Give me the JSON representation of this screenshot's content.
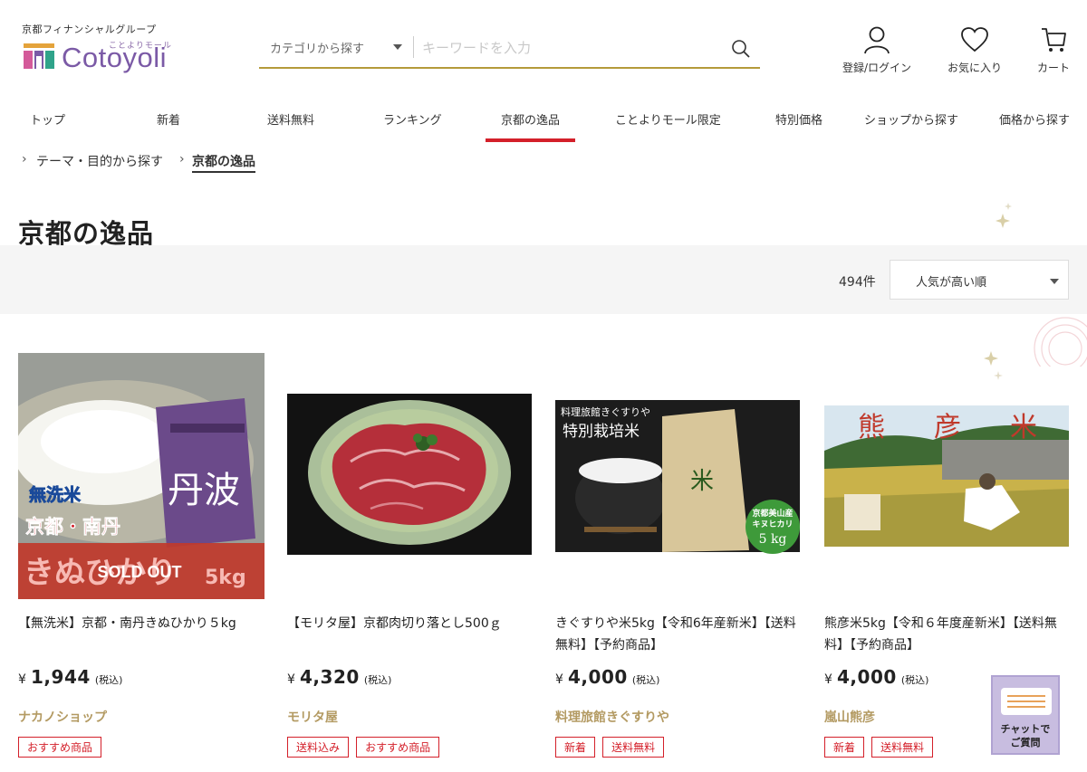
{
  "header": {
    "logo": {
      "group_text": "京都フィナンシャルグループ",
      "mall_text": "ことよりモール",
      "wordmark": "Cotoyoli"
    },
    "search": {
      "category_label": "カテゴリから探す",
      "placeholder": "キーワードを入力"
    },
    "icons": [
      {
        "name": "user-icon",
        "label": "登録/ログイン"
      },
      {
        "name": "heart-icon",
        "label": "お気に入り"
      },
      {
        "name": "cart-icon",
        "label": "カート"
      }
    ]
  },
  "nav": {
    "items": [
      "トップ",
      "新着",
      "送料無料",
      "ランキング",
      "京都の逸品",
      "ことよりモール限定",
      "特別価格",
      "ショップから探す",
      "価格から探す"
    ],
    "active": "京都の逸品"
  },
  "breadcrumb": {
    "items": [
      "テーマ・目的から探す",
      "京都の逸品"
    ]
  },
  "page": {
    "title": "京都の逸品"
  },
  "toolbar": {
    "count": "494件",
    "sort_label": "人気が高い順"
  },
  "products": [
    {
      "image": {
        "tag1": "無洗米",
        "tag2": "京都・南丹",
        "band_text": "きぬひかり",
        "band_weight": "5kg",
        "sold_out": "SOLD OUT",
        "bag_text": "丹波"
      },
      "name": "【無洗米】京都・南丹きぬひかり５kg",
      "price_yen": "¥",
      "price": "1,944",
      "price_tax": "(税込)",
      "shop": "ナカノショップ",
      "tags": [
        "おすすめ商品"
      ]
    },
    {
      "image": {},
      "name": "【モリタ屋】京都肉切り落とし500ｇ",
      "price_yen": "¥",
      "price": "4,320",
      "price_tax": "(税込)",
      "shop": "モリタ屋",
      "tags": [
        "送料込み",
        "おすすめ商品"
      ]
    },
    {
      "image": {
        "top_text": "料理旅館きぐすりや",
        "brand_text": "特別栽培米",
        "badge_line1": "京都美山産",
        "badge_line2": "キヌヒカリ",
        "badge_weight": "5 kg"
      },
      "name": "きぐすりや米5kg【令和6年産新米】【送料無料】【予約商品】",
      "price_yen": "¥",
      "price": "4,000",
      "price_tax": "(税込)",
      "shop": "料理旅館きぐすりや",
      "tags": [
        "新着",
        "送料無料"
      ]
    },
    {
      "image": {
        "chars": [
          "熊",
          "彦",
          "米"
        ]
      },
      "name": "熊彦米5kg【令和６年度産新米】【送料無料】【予約商品】",
      "price_yen": "¥",
      "price": "4,000",
      "price_tax": "(税込)",
      "shop": "嵐山熊彦",
      "tags": [
        "新着",
        "送料無料"
      ]
    }
  ],
  "chat": {
    "label_line1": "チャットで",
    "label_line2": "ご質問"
  },
  "colors": {
    "accent_red": "#d4202a",
    "brand_purple": "#7b5aa6",
    "search_underline": "#b49a3a",
    "shop_gold": "#b39a62",
    "chat_bg": "#c8bde0"
  }
}
